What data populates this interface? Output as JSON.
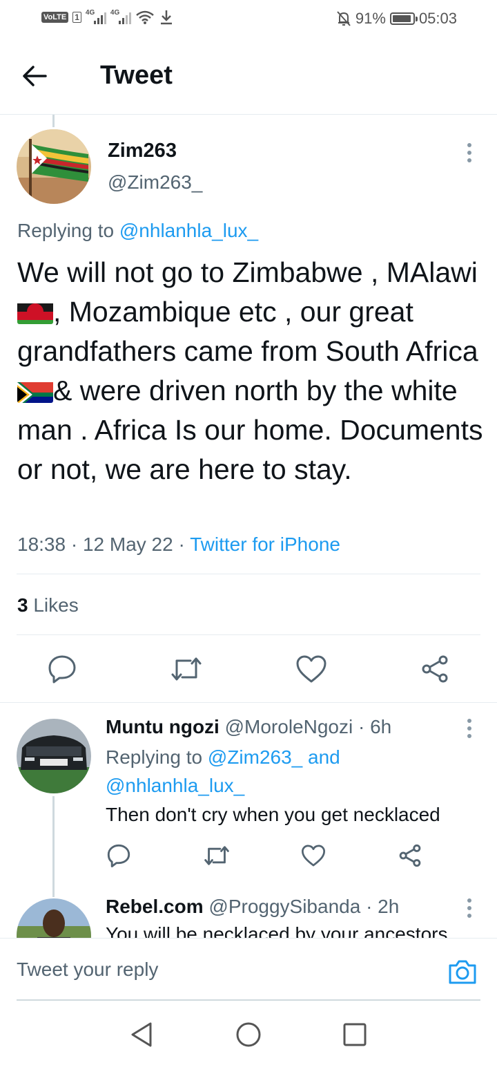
{
  "status_bar": {
    "volte": "VoLTE",
    "sim": "1",
    "net1": "4G",
    "net2": "4G",
    "battery": "91%",
    "time": "05:03",
    "battery_level": 0.91
  },
  "header": {
    "title": "Tweet"
  },
  "tweet": {
    "author_name": "Zim263",
    "author_handle": "@Zim263_",
    "replying_prefix": "Replying to",
    "replying_to": "@nhlanhla_lux_",
    "text_part1": "We will not go to Zimbabwe , MAlawi",
    "text_part2": ", Mozambique etc , our great grandfathers came from South Africa",
    "text_part3": "& were driven north by the white man . Africa Is our home. Documents or not, we are here to stay.",
    "timestamp": "18:38 · 12 May 22 ·",
    "source": "Twitter for iPhone",
    "likes_count": "3",
    "likes_label": "Likes"
  },
  "replies": [
    {
      "name": "Muntu ngozi",
      "handle": "@MoroleNgozi · 6h",
      "replying_prefix": "Replying to",
      "replying_to": "@Zim263_ and @nhlanhla_lux_",
      "text": "Then don't cry when you get necklaced"
    },
    {
      "name": "Rebel.com",
      "handle": "@ProggySibanda · 2h",
      "text": "You will be necklaced by your ancestors"
    }
  ],
  "composer": {
    "placeholder": "Tweet your reply"
  },
  "colors": {
    "accent": "#1d9bf0",
    "text": "#0f1419",
    "secondary": "#536471",
    "divider": "#e6ecf0"
  },
  "icons": {
    "back": "arrow-left-icon",
    "more": "more-vertical-icon",
    "reply": "reply-bubble-icon",
    "retweet": "retweet-icon",
    "like": "heart-icon",
    "share": "share-icon",
    "camera": "camera-icon"
  }
}
